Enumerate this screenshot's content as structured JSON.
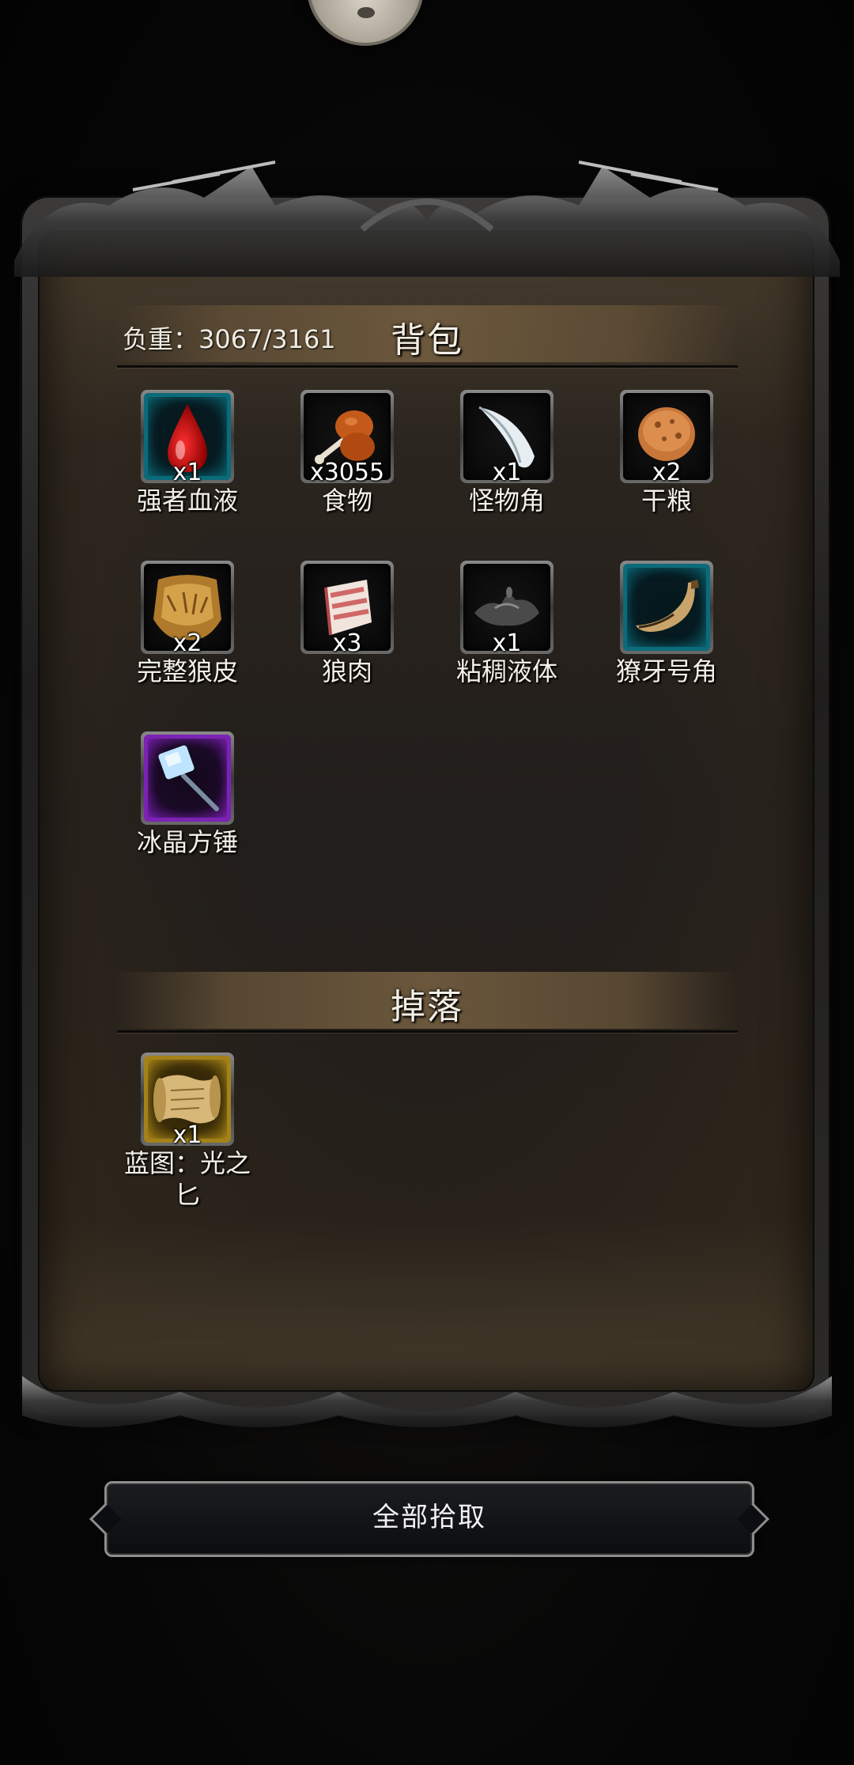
{
  "backpack": {
    "title": "背包",
    "load_text": "负重：3067/3161",
    "items": [
      {
        "name": "强者血液",
        "count": "x1",
        "icon": "blood-drop-icon",
        "rarity": "blue"
      },
      {
        "name": "食物",
        "count": "x3055",
        "icon": "meat-drumstick-icon",
        "rarity": "normal"
      },
      {
        "name": "怪物角",
        "count": "x1",
        "icon": "monster-horn-icon",
        "rarity": "normal"
      },
      {
        "name": "干粮",
        "count": "x2",
        "icon": "dry-bread-icon",
        "rarity": "normal"
      },
      {
        "name": "完整狼皮",
        "count": "x2",
        "icon": "wolf-pelt-icon",
        "rarity": "normal"
      },
      {
        "name": "狼肉",
        "count": "x3",
        "icon": "wolf-meat-icon",
        "rarity": "normal"
      },
      {
        "name": "粘稠液体",
        "count": "x1",
        "icon": "sticky-liquid-icon",
        "rarity": "normal"
      },
      {
        "name": "獠牙号角",
        "count": "",
        "icon": "fang-horn-icon",
        "rarity": "blue"
      },
      {
        "name": "冰晶方锤",
        "count": "",
        "icon": "ice-hammer-icon",
        "rarity": "purple"
      }
    ]
  },
  "drops": {
    "title": "掉落",
    "items": [
      {
        "name": "蓝图：光之匕",
        "count": "x1",
        "icon": "blueprint-scroll-icon",
        "rarity": "gold"
      }
    ]
  },
  "actions": {
    "collect_all_label": "全部拾取"
  },
  "colors": {
    "blue_rarity": "#0c6b7a",
    "purple_rarity": "#7c22b4",
    "gold_rarity": "#a4821a",
    "text": "#f4f0e8"
  }
}
